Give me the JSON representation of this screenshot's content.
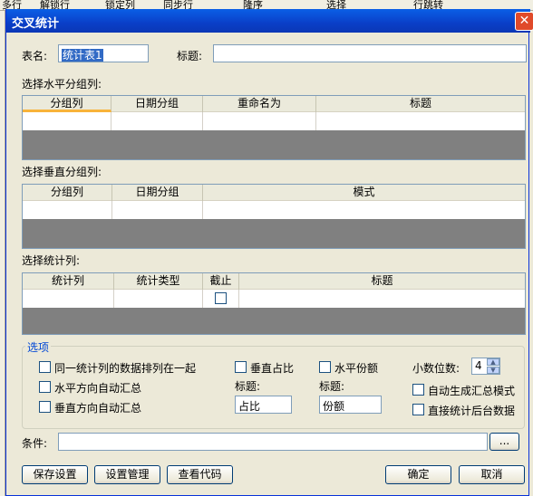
{
  "background": {
    "toolbar_items": [
      "多行",
      "解锁行",
      "锁定列",
      "同步行",
      "隆序",
      "选择",
      "行跳转"
    ]
  },
  "dialog": {
    "title": "交叉统计",
    "close_glyph": "✕"
  },
  "form": {
    "table_name_label": "表名:",
    "table_name_value": "统计表1",
    "title_label": "标题:",
    "title_value": ""
  },
  "horizontal": {
    "section_label": "选择水平分组列:",
    "columns": [
      "分组列",
      "日期分组",
      "重命名为",
      "标题"
    ]
  },
  "vertical": {
    "section_label": "选择垂直分组列:",
    "columns": [
      "分组列",
      "日期分组",
      "模式"
    ]
  },
  "stats": {
    "section_label": "选择统计列:",
    "columns": [
      "统计列",
      "统计类型",
      "截止",
      "标题"
    ]
  },
  "options": {
    "group_title": "选项",
    "same_stat_together": "同一统计列的数据排列在一起",
    "horizontal_auto_summary": "水平方向自动汇总",
    "vertical_auto_summary": "垂直方向自动汇总",
    "vertical_ratio": "垂直占比",
    "vertical_ratio_title_label": "标题:",
    "vertical_ratio_title_value": "占比",
    "horizontal_share": "水平份额",
    "horizontal_share_title_label": "标题:",
    "horizontal_share_title_value": "份额",
    "decimal_places_label": "小数位数:",
    "decimal_places_value": "4",
    "auto_summary_mode": "自动生成汇总模式",
    "direct_backend_data": "直接统计后台数据"
  },
  "condition": {
    "label": "条件:",
    "value": "",
    "browse_label": "..."
  },
  "buttons": {
    "save_settings": "保存设置",
    "manage_settings": "设置管理",
    "view_code": "查看代码",
    "ok": "确定",
    "cancel": "取消"
  }
}
